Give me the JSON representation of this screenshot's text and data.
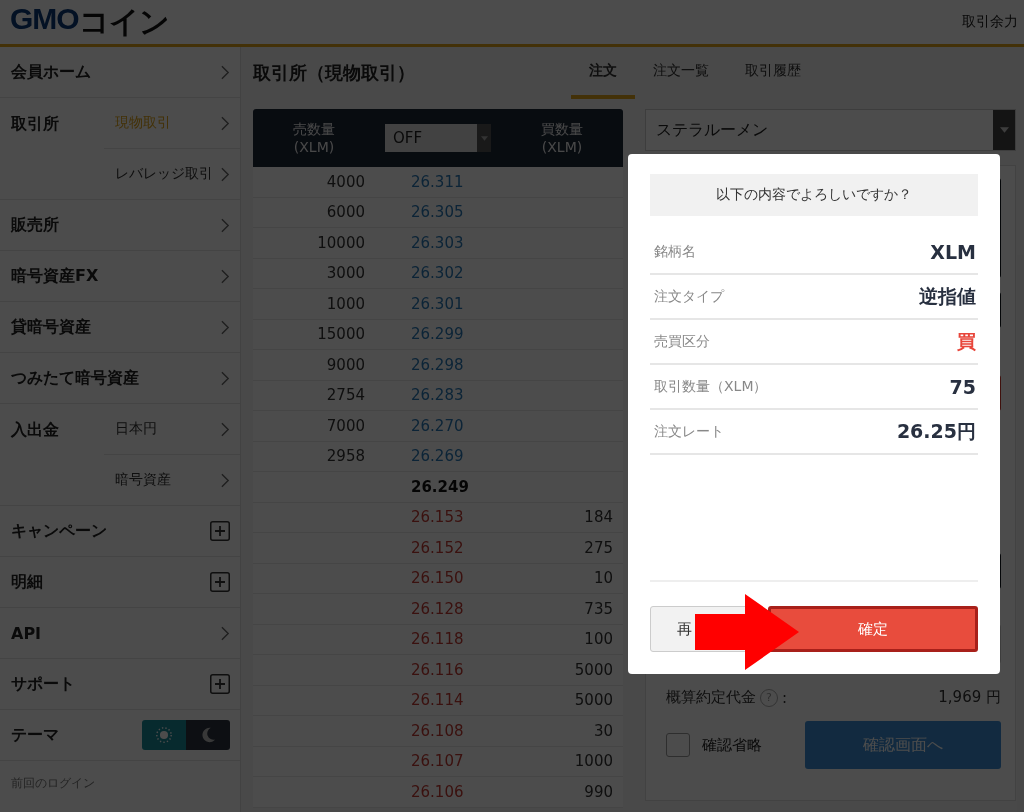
{
  "header": {
    "logo_latin": "GMO",
    "logo_kana": "コイン",
    "balance_label": "取引余力"
  },
  "sidebar": {
    "items": [
      {
        "label": "会員ホーム",
        "kind": "link"
      },
      {
        "label": "取引所",
        "kind": "group",
        "children": [
          {
            "label": "現物取引",
            "selected": true
          },
          {
            "label": "レバレッジ取引",
            "selected": false
          }
        ]
      },
      {
        "label": "販売所",
        "kind": "link"
      },
      {
        "label": "暗号資産FX",
        "kind": "link"
      },
      {
        "label": "貸暗号資産",
        "kind": "link"
      },
      {
        "label": "つみたて暗号資産",
        "kind": "link"
      },
      {
        "label": "入出金",
        "kind": "group",
        "children": [
          {
            "label": "日本円",
            "selected": false
          },
          {
            "label": "暗号資産",
            "selected": false
          }
        ]
      },
      {
        "label": "キャンペーン",
        "kind": "expand"
      },
      {
        "label": "明細",
        "kind": "expand"
      },
      {
        "label": "API",
        "kind": "link"
      },
      {
        "label": "サポート",
        "kind": "expand"
      }
    ],
    "theme": {
      "label": "テーマ",
      "options": [
        {
          "kind": "light",
          "selected": true
        },
        {
          "kind": "dark",
          "selected": false
        }
      ]
    },
    "last_login_label": "前回のログイン"
  },
  "page_title": "取引所（現物取引）",
  "tabs": [
    {
      "label": "注文",
      "selected": true
    },
    {
      "label": "注文一覧",
      "selected": false
    },
    {
      "label": "取引履歴",
      "selected": false
    }
  ],
  "order_book": {
    "sell_header": "売数量\n(XLM)",
    "grouping": "OFF",
    "buy_header": "買数量\n(XLM)",
    "rows": [
      {
        "kind": "ask",
        "sell": "4000",
        "price": "26.311"
      },
      {
        "kind": "ask",
        "sell": "6000",
        "price": "26.305"
      },
      {
        "kind": "ask",
        "sell": "10000",
        "price": "26.303"
      },
      {
        "kind": "ask",
        "sell": "3000",
        "price": "26.302"
      },
      {
        "kind": "ask",
        "sell": "1000",
        "price": "26.301"
      },
      {
        "kind": "ask",
        "sell": "15000",
        "price": "26.299"
      },
      {
        "kind": "ask",
        "sell": "9000",
        "price": "26.298"
      },
      {
        "kind": "ask",
        "sell": "2754",
        "price": "26.283"
      },
      {
        "kind": "ask",
        "sell": "7000",
        "price": "26.270"
      },
      {
        "kind": "ask",
        "sell": "2958",
        "price": "26.269"
      },
      {
        "kind": "mid",
        "price": "26.249"
      },
      {
        "kind": "bid",
        "price": "26.153",
        "buy": "184"
      },
      {
        "kind": "bid",
        "price": "26.152",
        "buy": "275"
      },
      {
        "kind": "bid",
        "price": "26.150",
        "buy": "10"
      },
      {
        "kind": "bid",
        "price": "26.128",
        "buy": "735"
      },
      {
        "kind": "bid",
        "price": "26.118",
        "buy": "100"
      },
      {
        "kind": "bid",
        "price": "26.116",
        "buy": "5000"
      },
      {
        "kind": "bid",
        "price": "26.114",
        "buy": "5000"
      },
      {
        "kind": "bid",
        "price": "26.108",
        "buy": "30"
      },
      {
        "kind": "bid",
        "price": "26.107",
        "buy": "1000"
      },
      {
        "kind": "bid",
        "price": "26.106",
        "buy": "990"
      }
    ]
  },
  "order_form": {
    "symbol_select": "ステラルーメン",
    "estimate_label": "概算約定代金",
    "help": "?",
    "colon": ":",
    "estimate_value": "1,969 円",
    "skip_confirm": {
      "label": "確認省略",
      "checked": false
    },
    "confirm_button": "確認画面へ"
  },
  "dialog": {
    "title": "以下の内容でよろしいですか？",
    "rows": [
      {
        "label": "銘柄名",
        "value": "XLM",
        "kind": "plain"
      },
      {
        "label": "注文タイプ",
        "value": "逆指値",
        "kind": "plain"
      },
      {
        "label": "売買区分",
        "value": "買",
        "kind": "buy"
      },
      {
        "label": "取引数量（XLM）",
        "value": "75",
        "kind": "plain"
      },
      {
        "label": "注文レート",
        "value": "26.25円",
        "kind": "plain"
      }
    ],
    "back_button": "再",
    "confirm_button": "確定"
  }
}
